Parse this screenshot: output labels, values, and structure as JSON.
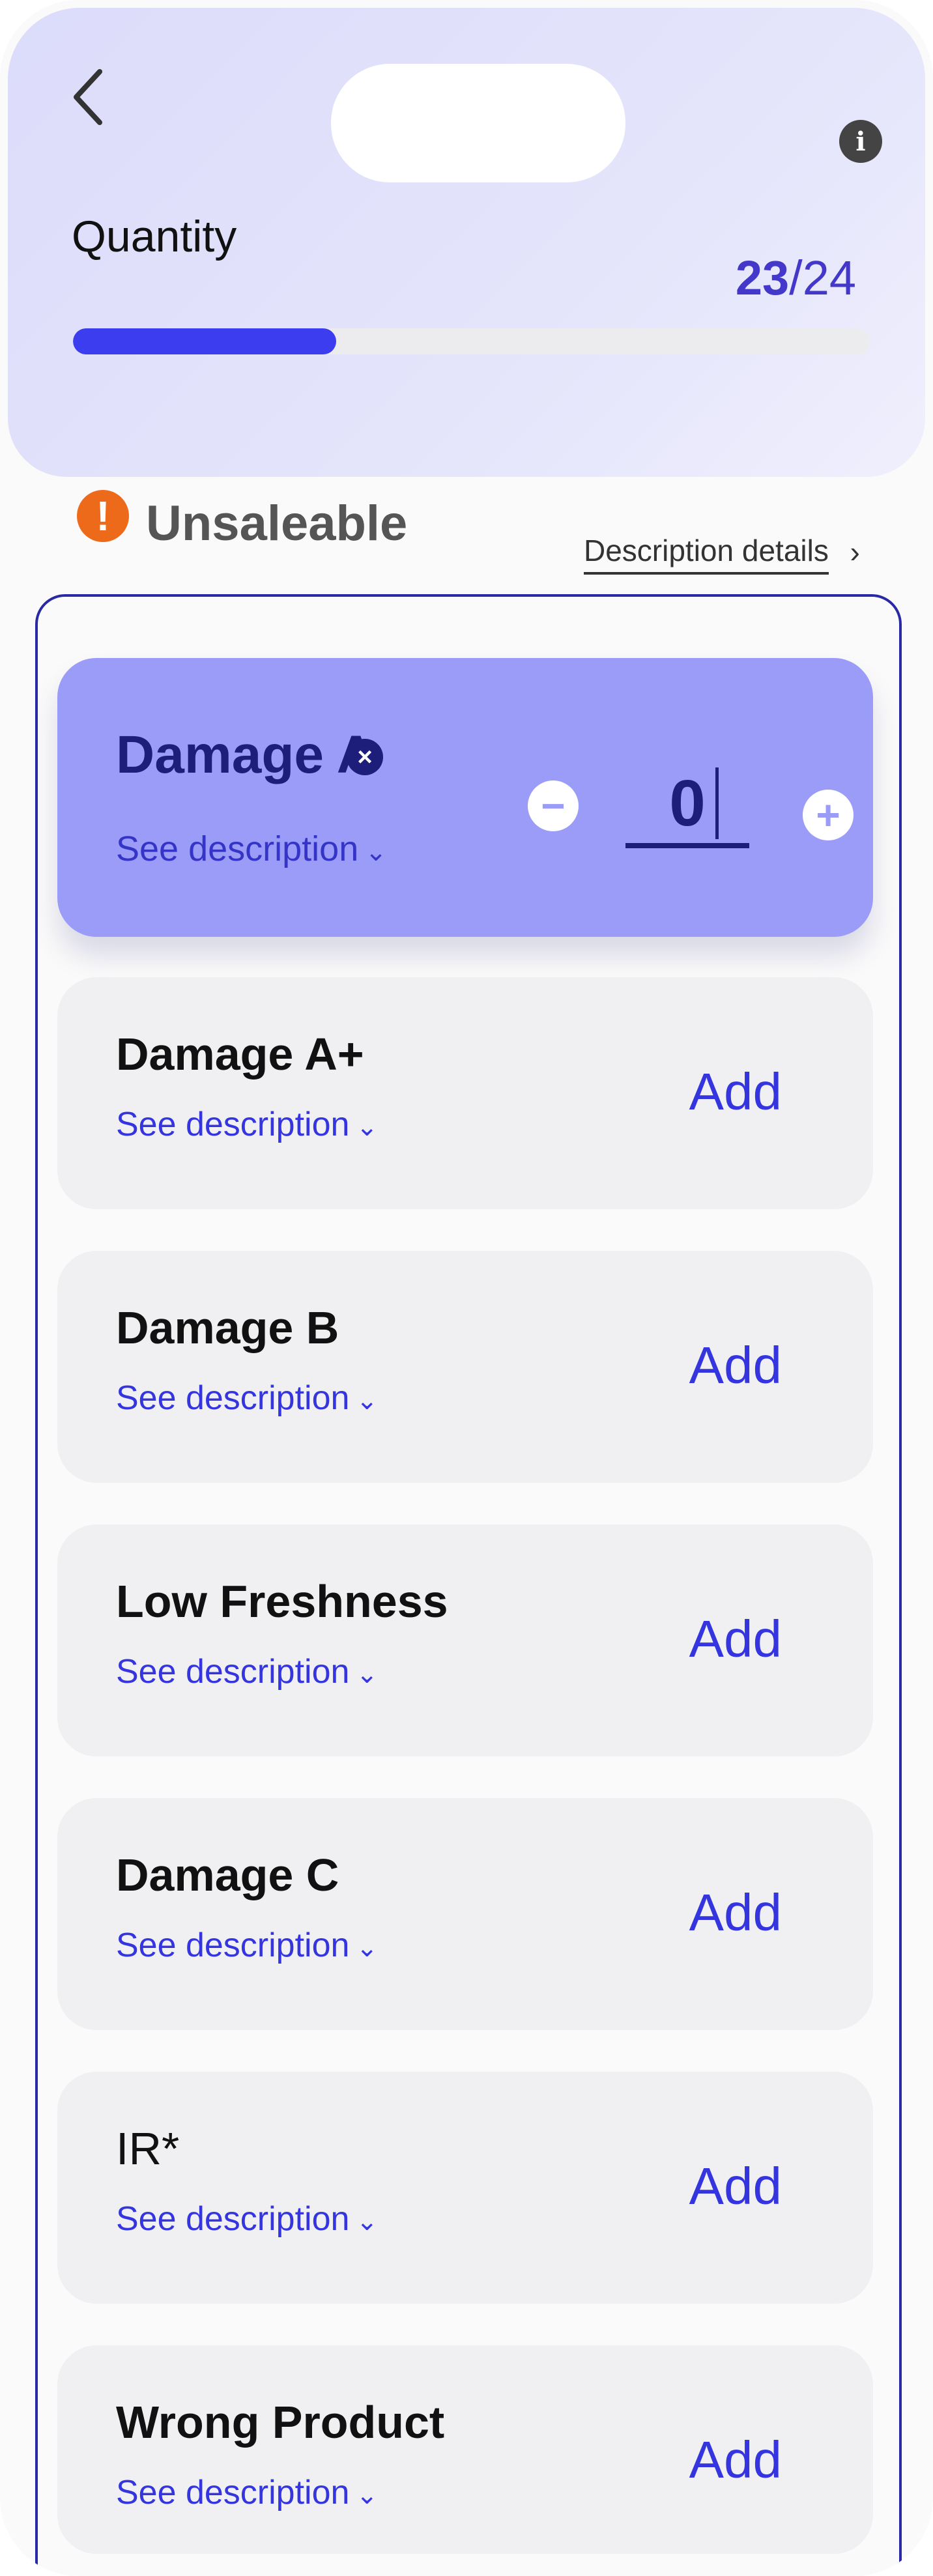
{
  "header": {
    "back_icon": "chevron-left-icon",
    "info_icon": "info-icon",
    "info_glyph": "i",
    "quantity_label": "Quantity",
    "count_current": "23",
    "count_separator": "/",
    "count_total": "24",
    "progress_fraction": 0.33,
    "accent_color": "#3d3df0"
  },
  "section": {
    "warning_icon": "exclamation-circle-icon",
    "warning_glyph": "!",
    "title": "Unsaleable",
    "details_link": "Description details",
    "details_chevron": "›"
  },
  "active_item": {
    "title": "Damage A",
    "see_description": "See description",
    "remove_glyph": "×",
    "minus_glyph": "−",
    "plus_glyph": "+",
    "quantity_value": "0"
  },
  "items": [
    {
      "title": "Damage A+",
      "see_description": "See description",
      "action": "Add"
    },
    {
      "title": "Damage B",
      "see_description": "See description",
      "action": "Add"
    },
    {
      "title": "Low Freshness",
      "see_description": "See description",
      "action": "Add"
    },
    {
      "title": "Damage C",
      "see_description": "See description",
      "action": "Add"
    },
    {
      "title": "IR*",
      "see_description": "See description",
      "action": "Add"
    },
    {
      "title": "Wrong Product",
      "see_description": "See description",
      "action": "Add"
    }
  ],
  "caret_glyph": "⌄"
}
